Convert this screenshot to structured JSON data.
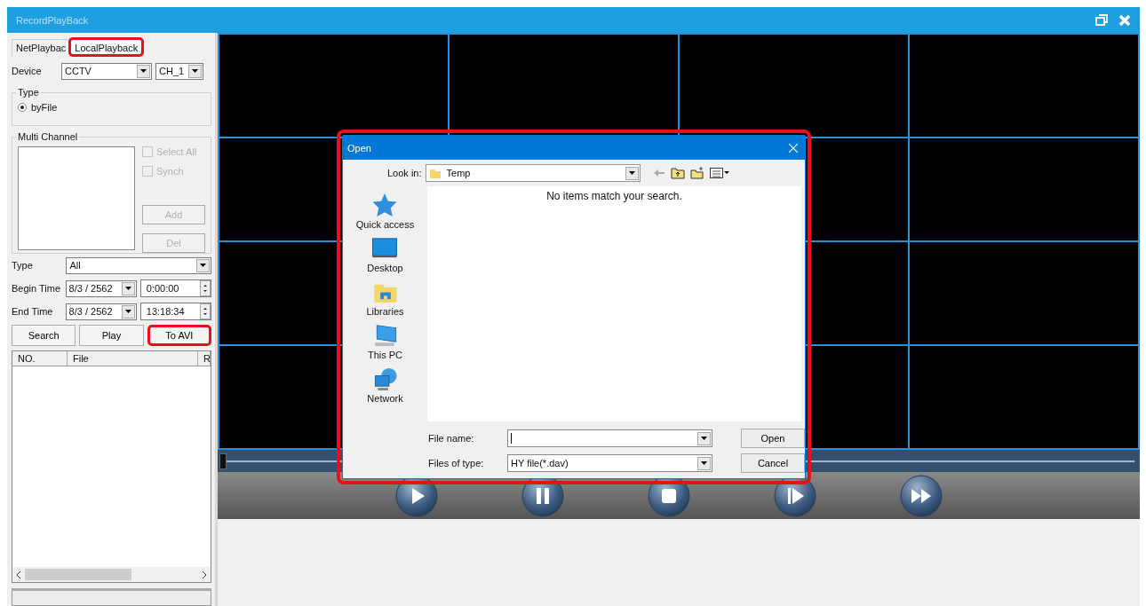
{
  "window": {
    "title": "RecordPlayBack"
  },
  "tabs": [
    {
      "label": "NetPlaybac",
      "selected": false,
      "highlighted": false
    },
    {
      "label": "LocalPlayback",
      "selected": true,
      "highlighted": true
    }
  ],
  "device": {
    "label": "Device",
    "value": "CCTV",
    "channel": "CH_1"
  },
  "type_group": {
    "title": "Type",
    "options": [
      {
        "label": "byFile",
        "selected": true
      }
    ]
  },
  "multi_channel": {
    "title": "Multi Channel",
    "checkboxes": [
      {
        "label": "Select All",
        "checked": false,
        "disabled": true
      },
      {
        "label": "Synch",
        "checked": false,
        "disabled": true
      }
    ],
    "buttons": [
      {
        "label": "Add",
        "disabled": true
      },
      {
        "label": "Del",
        "disabled": true
      }
    ]
  },
  "filter": {
    "type_label": "Type",
    "type_value": "All",
    "begin_label": "Begin Time",
    "begin_date": "8/3 / 2562",
    "begin_time": "0:00:00",
    "end_label": "End Time",
    "end_date": "8/3 / 2562",
    "end_time": "13:18:34"
  },
  "actions": [
    {
      "label": "Search",
      "highlighted": false
    },
    {
      "label": "Play",
      "highlighted": false
    },
    {
      "label": "To AVI",
      "highlighted": true
    }
  ],
  "file_list": {
    "columns": [
      "NO.",
      "File",
      "R"
    ]
  },
  "progress": {
    "level": 0
  },
  "player_buttons": [
    {
      "kind": "play"
    },
    {
      "kind": "pause"
    },
    {
      "kind": "stop"
    },
    {
      "kind": "step"
    },
    {
      "kind": "fast"
    }
  ],
  "dialog": {
    "title": "Open",
    "highlighted": true,
    "look_in_label": "Look in:",
    "look_in_value": "Temp",
    "places": [
      {
        "kind": "quick",
        "label": "Quick access"
      },
      {
        "kind": "desktop",
        "label": "Desktop"
      },
      {
        "kind": "libraries",
        "label": "Libraries"
      },
      {
        "kind": "pc",
        "label": "This PC"
      },
      {
        "kind": "network",
        "label": "Network"
      }
    ],
    "empty_message": "No items match your search.",
    "file_name_label": "File name:",
    "file_type_label": "Files of type:",
    "file_type_value": "HY file(*.dav)",
    "buttons": [
      "Open",
      "Cancel"
    ]
  }
}
